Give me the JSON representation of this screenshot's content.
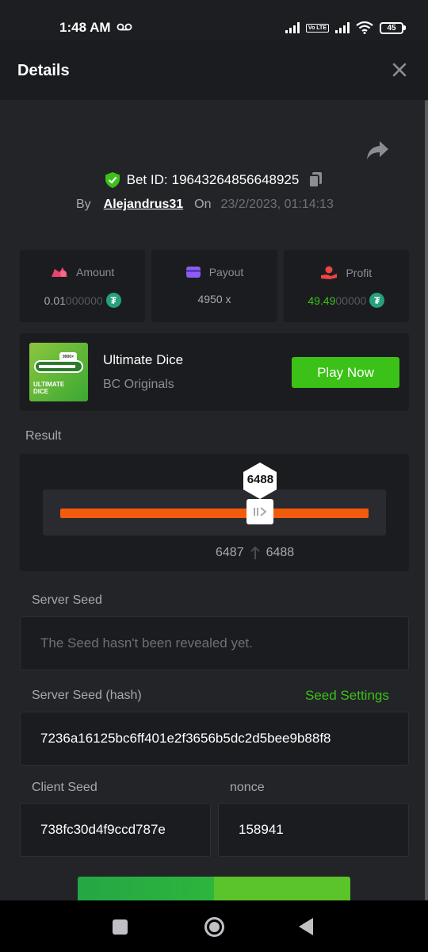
{
  "status_bar": {
    "time": "1:48 AM",
    "network": "Vo LTE",
    "battery": "45"
  },
  "header": {
    "title": "Details"
  },
  "bet": {
    "bet_id_label": "Bet ID:",
    "bet_id": "19643264856648925",
    "by_label": "By",
    "user": "Alejandrus31",
    "on_label": "On",
    "date": "23/2/2023, 01:14:13"
  },
  "stats": {
    "amount": {
      "label": "Amount",
      "value_main": "0.01",
      "value_dim": "000000",
      "currency_symbol": "₮"
    },
    "payout": {
      "label": "Payout",
      "value": "4950 x"
    },
    "profit": {
      "label": "Profit",
      "value_main": "49.49",
      "value_dim": "00000",
      "currency_symbol": "₮"
    }
  },
  "game": {
    "thumb_text": "ULTIMATE DICE",
    "thumb_badge": "9900×",
    "name": "Ultimate Dice",
    "provider": "BC Originals",
    "play_label": "Play Now"
  },
  "result": {
    "label": "Result",
    "value": "6488",
    "range_low": "6487",
    "range_high": "6488",
    "slider_fraction": 0.6488
  },
  "server_seed": {
    "label": "Server Seed",
    "value": "The Seed hasn't been revealed yet."
  },
  "server_seed_hash": {
    "label": "Server Seed (hash)",
    "settings_label": "Seed Settings",
    "value": "7236a16125bc6ff401e2f3656b5dc2d5bee9b88f8"
  },
  "client_seed": {
    "label": "Client Seed",
    "value": "738fc30d4f9ccd787e"
  },
  "nonce": {
    "label": "nonce",
    "value": "158941"
  },
  "colors": {
    "accent_green": "#3bc117",
    "slider_orange": "#f15b0b",
    "panel": "#1b1c20",
    "background": "#232428"
  }
}
